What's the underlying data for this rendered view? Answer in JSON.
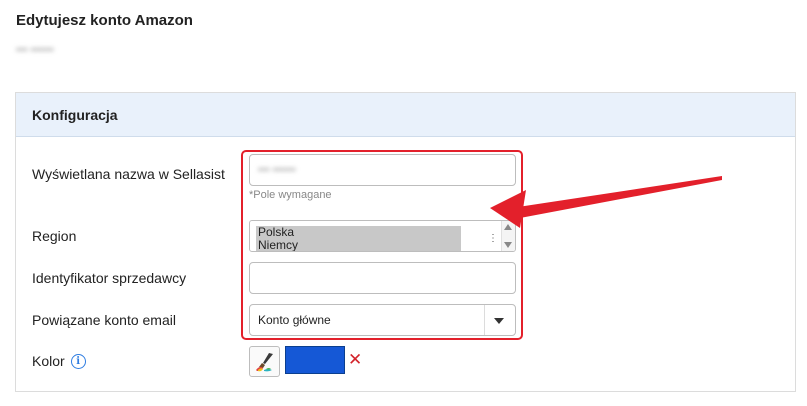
{
  "page": {
    "title": "Edytujesz konto Amazon",
    "subtitle_blurred": "••• ••••••"
  },
  "card": {
    "header": "Konfiguracja"
  },
  "form": {
    "name": {
      "label": "Wyświetlana nazwa w Sellasist",
      "value_blurred": "••• ••••••",
      "required_note": "*Pole wymagane"
    },
    "region": {
      "label": "Region",
      "options": [
        "Polska",
        "Niemcy"
      ]
    },
    "seller_id": {
      "label": "Identyfikator sprzedawcy",
      "value": ""
    },
    "email": {
      "label": "Powiązane konto email",
      "selected": "Konto główne"
    },
    "color": {
      "label": "Kolor",
      "info_icon": "info-icon",
      "picker_icon": "paint-brush-icon",
      "value": "#1558d6",
      "clear_icon": "close-icon",
      "clear_symbol": "✕"
    }
  },
  "annotation": {
    "highlight_color": "#e3202b"
  }
}
